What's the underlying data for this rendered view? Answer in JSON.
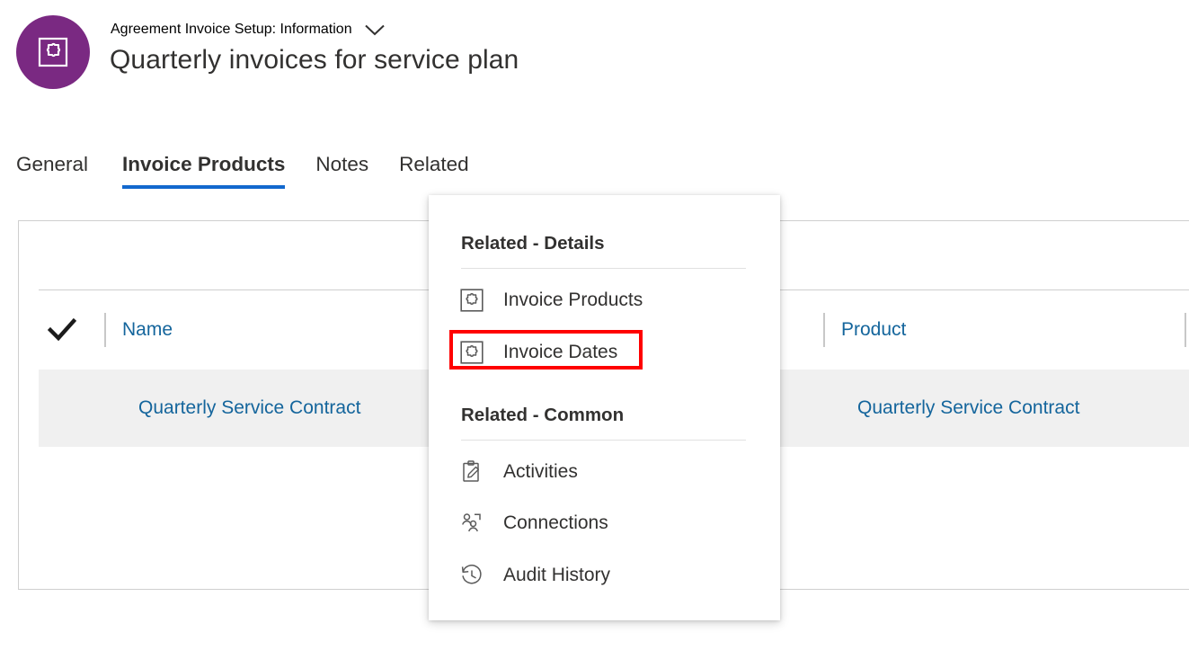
{
  "header": {
    "avatar_icon": "entity-puzzle-icon",
    "avatar_color": "#7A2982",
    "eyebrow": "Agreement Invoice Setup: Information",
    "chevron_icon": "chevron-down-icon",
    "title": "Quarterly invoices for service plan"
  },
  "tabs": {
    "accent_color": "#1268CE",
    "items": [
      {
        "label": "General",
        "active": false
      },
      {
        "label": "Invoice Products",
        "active": true
      },
      {
        "label": "Notes",
        "active": false
      },
      {
        "label": "Related",
        "active": false
      }
    ]
  },
  "grid": {
    "select_all_icon": "checkmark-icon",
    "columns": [
      {
        "label": "Name"
      },
      {
        "label": "Product"
      }
    ],
    "rows": [
      {
        "name": "Quarterly Service Contract",
        "product": "Quarterly Service Contract",
        "selected": true
      }
    ],
    "link_color": "#14659C",
    "row_highlight_color": "#f0f0f0"
  },
  "flyout": {
    "groups": [
      {
        "title": "Related - Details",
        "items": [
          {
            "label": "Invoice Products",
            "icon": "entity-puzzle-icon",
            "highlighted": false
          },
          {
            "label": "Invoice Dates",
            "icon": "entity-puzzle-icon",
            "highlighted": true
          }
        ]
      },
      {
        "title": "Related - Common",
        "items": [
          {
            "label": "Activities",
            "icon": "clipboard-pen-icon",
            "highlighted": false
          },
          {
            "label": "Connections",
            "icon": "people-connection-icon",
            "highlighted": false
          },
          {
            "label": "Audit History",
            "icon": "history-clock-icon",
            "highlighted": false
          }
        ]
      }
    ],
    "highlight_color": "#FF0000"
  }
}
